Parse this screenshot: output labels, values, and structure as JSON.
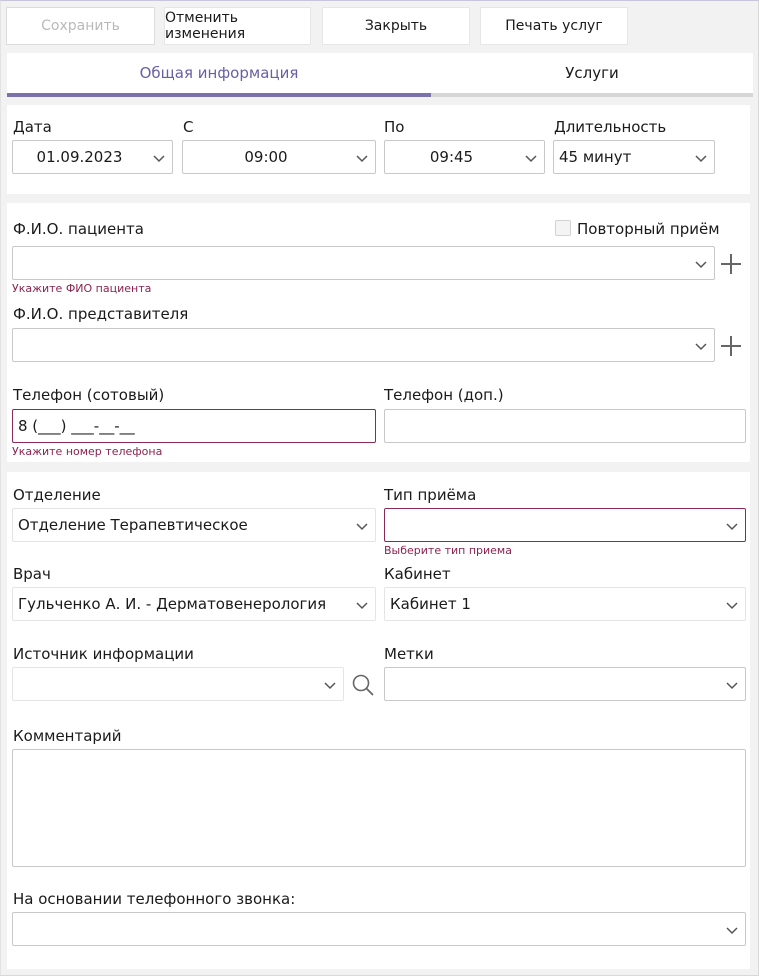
{
  "toolbar": {
    "save_label": "Сохранить",
    "cancel_label": "Отменить изменения",
    "close_label": "Закрыть",
    "print_label": "Печать услуг"
  },
  "tabs": [
    {
      "label": "Общая информация",
      "active": true
    },
    {
      "label": "Услуги",
      "active": false
    }
  ],
  "schedule": {
    "date_label": "Дата",
    "date_value": "01.09.2023",
    "from_label": "С",
    "from_value": "09:00",
    "to_label": "По",
    "to_value": "09:45",
    "duration_label": "Длительность",
    "duration_value": "45 минут"
  },
  "patient": {
    "name_label": "Ф.И.О. пациента",
    "name_value": "",
    "name_error": "Укажите ФИО пациента",
    "repeat_label": "Повторный приём",
    "repeat_checked": false,
    "rep_label": "Ф.И.О. представителя",
    "rep_value": "",
    "phone_label": "Телефон (сотовый)",
    "phone_value": "8 (___) ___-__-__",
    "phone_error": "Укажите номер телефона",
    "phone2_label": "Телефон (доп.)",
    "phone2_value": ""
  },
  "visit": {
    "department_label": "Отделение",
    "department_value": "Отделение Терапевтическое",
    "type_label": "Тип приёма",
    "type_value": "",
    "type_error": "Выберите тип приема",
    "doctor_label": "Врач",
    "doctor_value": "Гульченко А. И. - Дерматовенерология",
    "room_label": "Кабинет",
    "room_value": "Кабинет 1",
    "source_label": "Источник информации",
    "source_value": "",
    "tags_label": "Метки",
    "tags_value": "",
    "comment_label": "Комментарий",
    "comment_value": "",
    "call_label": "На основании телефонного звонка:",
    "call_value": ""
  },
  "colors": {
    "accent": "#7b72ad",
    "error": "#8a2350",
    "background": "#f2f2f2"
  },
  "icons": [
    "chevron-down-icon",
    "plus-icon",
    "search-icon"
  ]
}
